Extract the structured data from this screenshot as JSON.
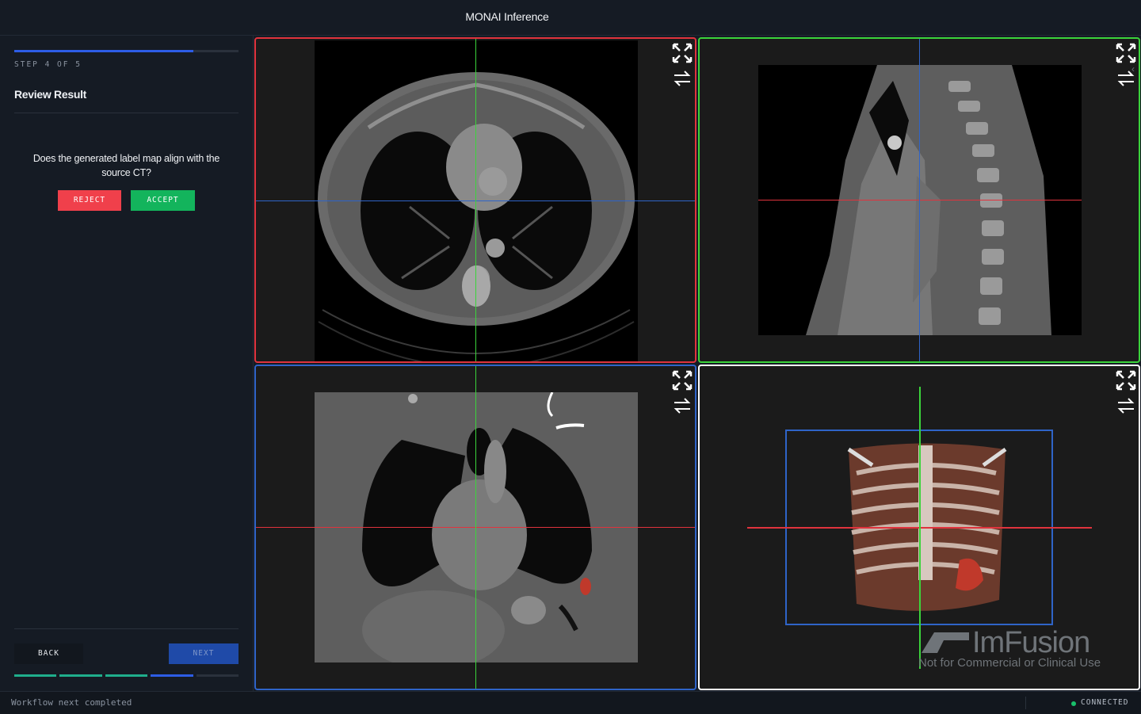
{
  "header": {
    "title": "MONAI Inference"
  },
  "sidebar": {
    "progress_fraction": 0.8,
    "step_label": "STEP 4 OF 5",
    "section_title": "Review Result",
    "question": "Does the generated label map align with the source CT?",
    "reject_label": "REJECT",
    "accept_label": "ACCEPT",
    "back_label": "BACK",
    "next_label": "NEXT",
    "steps": [
      {
        "state": "done",
        "color": "#1fae8c"
      },
      {
        "state": "done",
        "color": "#1fae8c"
      },
      {
        "state": "done",
        "color": "#1fae8c"
      },
      {
        "state": "current",
        "color": "#2d5de6"
      },
      {
        "state": "pending",
        "color": "#2a313c"
      }
    ]
  },
  "viewports": [
    {
      "id": "axial",
      "border_color": "#e0333d",
      "h_line_color": "#2f64c8",
      "v_line_color": "#3bd43b",
      "icons": [
        "maximize-icon",
        "swap-icon"
      ]
    },
    {
      "id": "sagittal",
      "border_color": "#3bd43b",
      "h_line_color": "#e0333d",
      "v_line_color": "#2f64c8",
      "icons": [
        "maximize-icon",
        "swap-icon"
      ]
    },
    {
      "id": "coronal",
      "border_color": "#2f64c8",
      "h_line_color": "#e0333d",
      "v_line_color": "#3bd43b",
      "icons": [
        "maximize-icon",
        "swap-icon"
      ]
    },
    {
      "id": "3d",
      "border_color": "#ffffff",
      "h_line_color": "#e0333d",
      "v_line_color": "#3bd43b",
      "box_color": "#2f64c8",
      "icons": [
        "maximize-icon",
        "swap-icon"
      ]
    }
  ],
  "watermark": {
    "logo": "ImFusion",
    "notice": "Not for Commercial or Clinical Use"
  },
  "status": {
    "message": "Workflow next completed",
    "connection": "CONNECTED",
    "connection_color": "#19c06b"
  }
}
